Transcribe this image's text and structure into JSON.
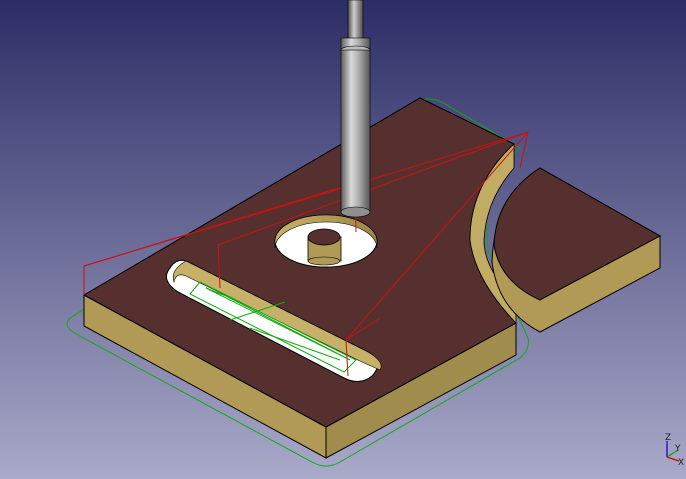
{
  "axis_indicator": {
    "z_label": "Z",
    "y_label": "Y",
    "x_label": "X"
  },
  "colors": {
    "background_top": "#2d2d66",
    "background_bottom": "#a9a9c9",
    "part_top_face": "#55302f",
    "part_side_face": "#b09a55",
    "part_side_shadow": "#8c7a42",
    "edge_color": "#000000",
    "toolpath_rapid": "#cc1111",
    "toolpath_feed": "#11aa11",
    "tool_body": "#a8a8a8",
    "tool_shaft": "#8a8a8a"
  },
  "icons": {
    "tool": "endmill-tool-icon",
    "axis": "axis-cross-icon"
  }
}
